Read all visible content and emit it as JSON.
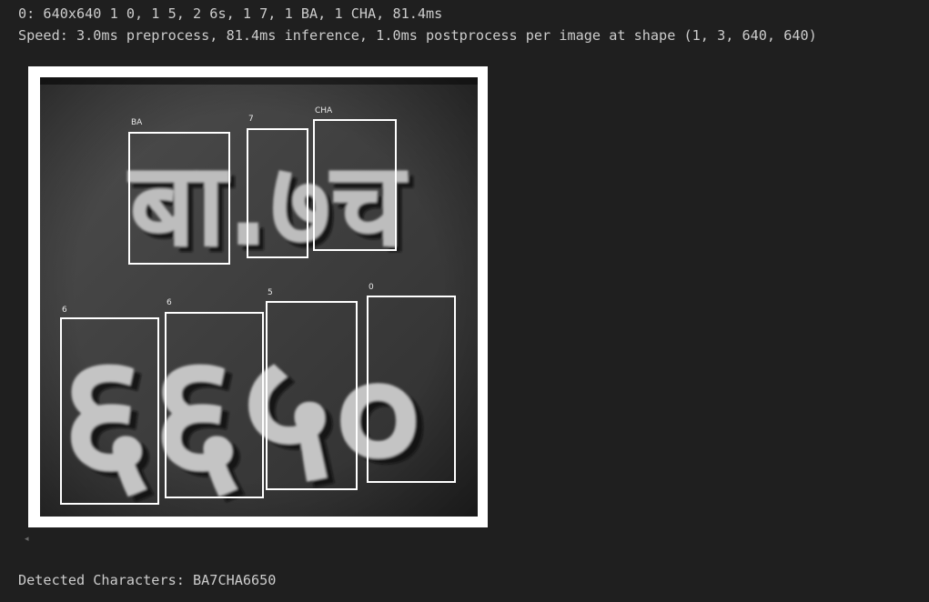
{
  "output": {
    "line1": "0: 640x640 1 0, 1 5, 2 6s, 1 7, 1 BA, 1 CHA, 81.4ms",
    "line2": "Speed: 3.0ms preprocess, 81.4ms inference, 1.0ms postprocess per image at shape (1, 3, 640, 640)",
    "line3": "Detected Characters: BA7CHA6650"
  },
  "image": {
    "plate_top_text": "बा.७च",
    "plate_bottom_text": "६६५०",
    "detections": [
      {
        "label": "BA"
      },
      {
        "label": "7"
      },
      {
        "label": "CHA"
      },
      {
        "label": "6"
      },
      {
        "label": "6"
      },
      {
        "label": "5"
      },
      {
        "label": "0"
      }
    ]
  },
  "scroll_arrow_icon": "triangle-left-icon"
}
